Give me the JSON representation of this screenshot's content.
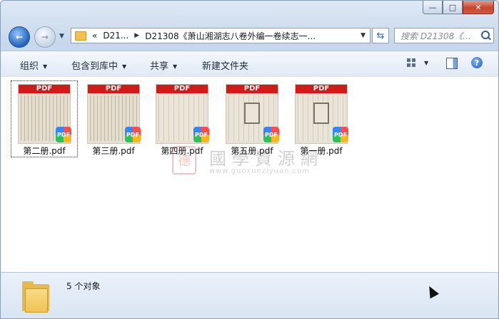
{
  "window": {
    "caption": {
      "minimize": "—",
      "maximize": "□",
      "close": "✕"
    }
  },
  "address_bar": {
    "overflow": "«",
    "segments": [
      "D21...",
      "D21308《萧山湘湖志八卷外编一卷续志一..."
    ],
    "refresh_icon": "refresh-icon"
  },
  "search": {
    "placeholder": "搜索 D21308《..."
  },
  "toolbar": {
    "organize": "组织",
    "include_in_library": "包含到库中",
    "share": "共享",
    "new_folder": "新建文件夹"
  },
  "files": [
    {
      "name": "第二册.pdf",
      "banner": "PDF",
      "badge": "PDF",
      "selected": true
    },
    {
      "name": "第三册.pdf",
      "banner": "PDF",
      "badge": "PDF",
      "selected": false
    },
    {
      "name": "第四册.pdf",
      "banner": "PDF",
      "badge": "PDF",
      "selected": false
    },
    {
      "name": "第五册.pdf",
      "banner": "PDF",
      "badge": "PDF",
      "selected": false
    },
    {
      "name": "第一册.pdf",
      "banner": "PDF",
      "badge": "PDF",
      "selected": false
    }
  ],
  "watermark": {
    "title": "國學資源網",
    "url": "www.guoxueziyuan.com"
  },
  "status": {
    "count_text": "5 个对象"
  }
}
